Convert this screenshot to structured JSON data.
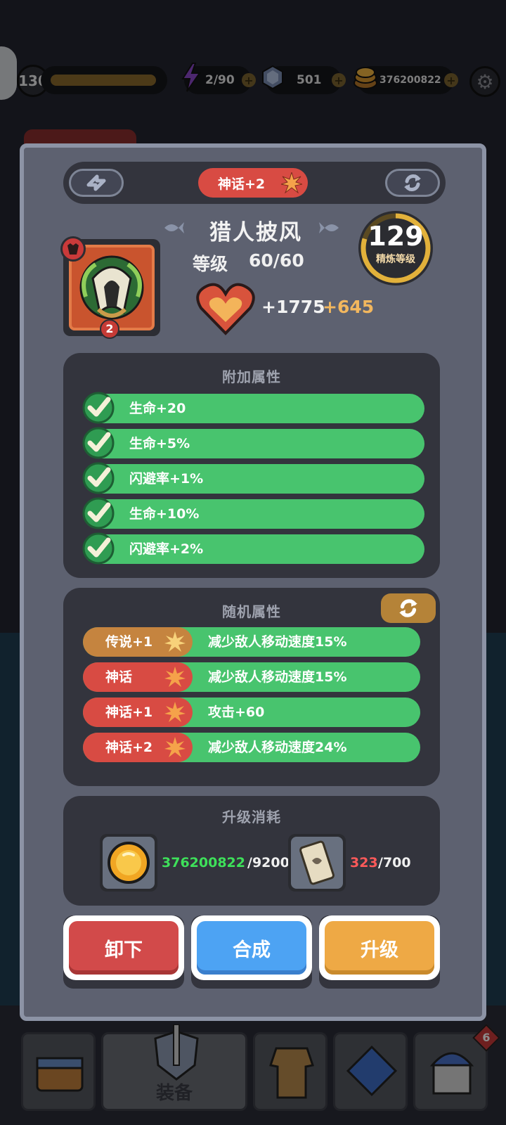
{
  "hud": {
    "player_level": "130",
    "energy": "2/90",
    "gems": "501",
    "gold": "376200822",
    "settings_icon": "gear-icon"
  },
  "item": {
    "rank": "神话+2",
    "name": "猎人披风",
    "level_label": "等级",
    "level_value": "60/60",
    "stat_icon": "heart-icon",
    "stat_base": "+1775",
    "stat_bonus": "+645",
    "count": "2",
    "refine_level": "129",
    "refine_label": "精炼等级"
  },
  "extra_attributes": {
    "title": "附加属性",
    "rows": [
      {
        "text": "生命+20"
      },
      {
        "text": "生命+5%"
      },
      {
        "text": "闪避率+1%"
      },
      {
        "text": "生命+10%"
      },
      {
        "text": "闪避率+2%"
      }
    ]
  },
  "random_attributes": {
    "title": "随机属性",
    "rows": [
      {
        "tag": "传说+1",
        "tag_color": "#c5843f",
        "text": "减少敌人移动速度15%"
      },
      {
        "tag": "神话",
        "tag_color": "#d84b43",
        "text": "减少敌人移动速度15%"
      },
      {
        "tag": "神话+1",
        "tag_color": "#d84b43",
        "text": "攻击+60"
      },
      {
        "tag": "神话+2",
        "tag_color": "#d84b43",
        "text": "减少敌人移动速度24%"
      }
    ]
  },
  "upgrade_cost": {
    "title": "升级消耗",
    "gold_have": "376200822",
    "gold_need": "/9200",
    "scroll_have": "323",
    "scroll_need": "/700"
  },
  "buttons": {
    "unequip": "卸下",
    "merge": "合成",
    "upgrade": "升级"
  },
  "bottom_nav": {
    "equipment_label": "装备",
    "badge_count": "6"
  },
  "colors": {
    "mythic": "#d84b43",
    "legend": "#c5843f",
    "green": "#48c46e",
    "bonus": "#f2b75e",
    "gold_enough": "#3ee05a",
    "not_enough": "#ff5a5a"
  }
}
